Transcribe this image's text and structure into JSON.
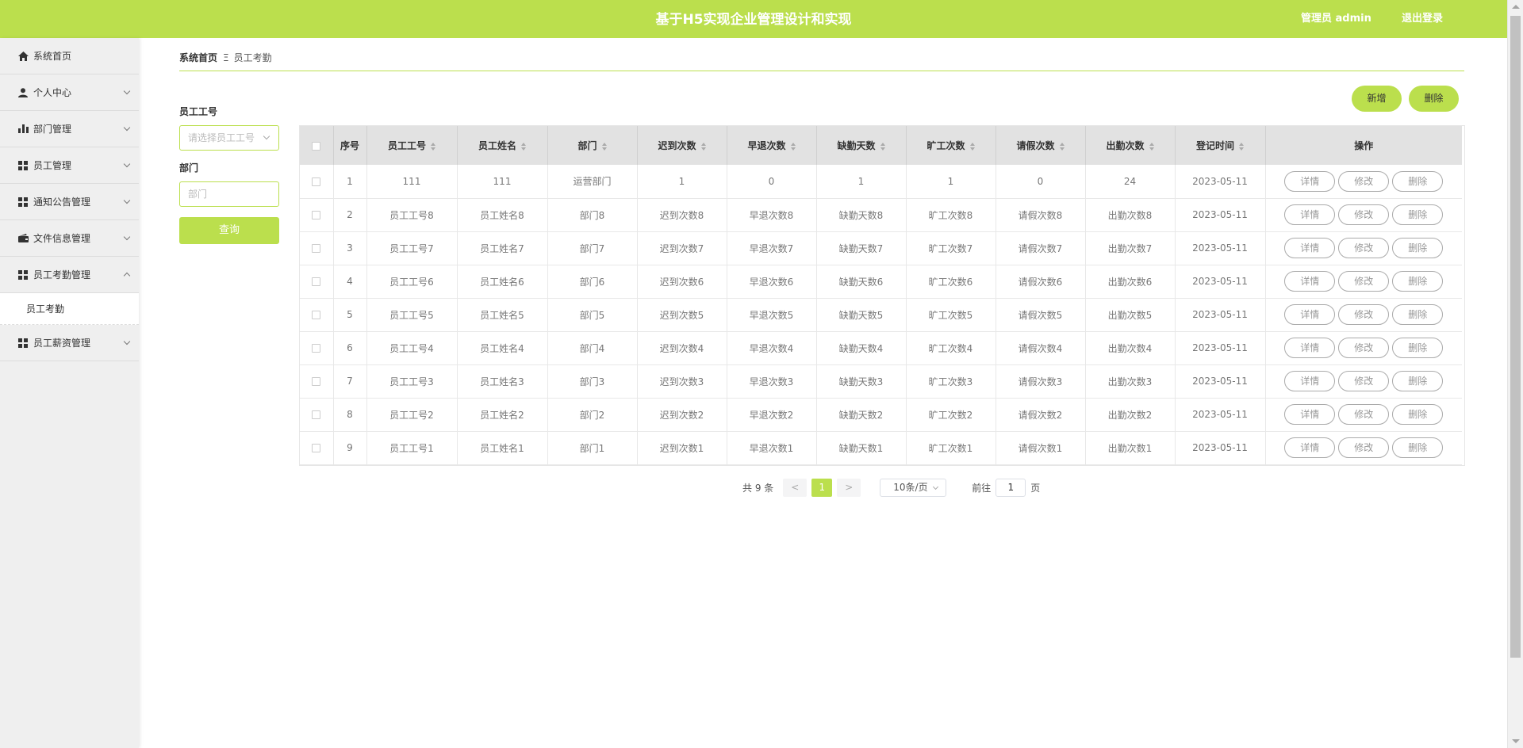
{
  "header": {
    "title": "基于H5实现企业管理设计和实现",
    "user": "管理员 admin",
    "logout": "退出登录"
  },
  "sidebar": {
    "items": [
      {
        "label": "系统首页"
      },
      {
        "label": "个人中心"
      },
      {
        "label": "部门管理"
      },
      {
        "label": "员工管理"
      },
      {
        "label": "通知公告管理"
      },
      {
        "label": "文件信息管理"
      },
      {
        "label": "员工考勤管理"
      },
      {
        "label": "员工薪资管理"
      }
    ],
    "subitem": "员工考勤"
  },
  "breadcrumb": {
    "home": "系统首页",
    "separator": "Ξ",
    "current": "员工考勤"
  },
  "search": {
    "emp_no_label": "员工工号",
    "emp_no_placeholder": "请选择员工工号",
    "dept_label": "部门",
    "dept_placeholder": "部门",
    "query": "查询"
  },
  "actions": {
    "add": "新增",
    "delete": "删除"
  },
  "table": {
    "headers": [
      "序号",
      "员工工号",
      "员工姓名",
      "部门",
      "迟到次数",
      "早退次数",
      "缺勤天数",
      "旷工次数",
      "请假次数",
      "出勤次数",
      "登记时间",
      "操作"
    ],
    "op_labels": {
      "detail": "详情",
      "edit": "修改",
      "delete": "删除"
    },
    "rows": [
      [
        "1",
        "111",
        "111",
        "运营部门",
        "1",
        "0",
        "1",
        "1",
        "0",
        "24",
        "2023-05-11"
      ],
      [
        "2",
        "员工工号8",
        "员工姓名8",
        "部门8",
        "迟到次数8",
        "早退次数8",
        "缺勤天数8",
        "旷工次数8",
        "请假次数8",
        "出勤次数8",
        "2023-05-11"
      ],
      [
        "3",
        "员工工号7",
        "员工姓名7",
        "部门7",
        "迟到次数7",
        "早退次数7",
        "缺勤天数7",
        "旷工次数7",
        "请假次数7",
        "出勤次数7",
        "2023-05-11"
      ],
      [
        "4",
        "员工工号6",
        "员工姓名6",
        "部门6",
        "迟到次数6",
        "早退次数6",
        "缺勤天数6",
        "旷工次数6",
        "请假次数6",
        "出勤次数6",
        "2023-05-11"
      ],
      [
        "5",
        "员工工号5",
        "员工姓名5",
        "部门5",
        "迟到次数5",
        "早退次数5",
        "缺勤天数5",
        "旷工次数5",
        "请假次数5",
        "出勤次数5",
        "2023-05-11"
      ],
      [
        "6",
        "员工工号4",
        "员工姓名4",
        "部门4",
        "迟到次数4",
        "早退次数4",
        "缺勤天数4",
        "旷工次数4",
        "请假次数4",
        "出勤次数4",
        "2023-05-11"
      ],
      [
        "7",
        "员工工号3",
        "员工姓名3",
        "部门3",
        "迟到次数3",
        "早退次数3",
        "缺勤天数3",
        "旷工次数3",
        "请假次数3",
        "出勤次数3",
        "2023-05-11"
      ],
      [
        "8",
        "员工工号2",
        "员工姓名2",
        "部门2",
        "迟到次数2",
        "早退次数2",
        "缺勤天数2",
        "旷工次数2",
        "请假次数2",
        "出勤次数2",
        "2023-05-11"
      ],
      [
        "9",
        "员工工号1",
        "员工姓名1",
        "部门1",
        "迟到次数1",
        "早退次数1",
        "缺勤天数1",
        "旷工次数1",
        "请假次数1",
        "出勤次数1",
        "2023-05-11"
      ]
    ]
  },
  "pagination": {
    "total": "共 9 条",
    "prev": "<",
    "current": "1",
    "next": ">",
    "page_size": "10条/页",
    "goto_prefix": "前往",
    "goto_value": "1",
    "goto_suffix": "页"
  },
  "colors": {
    "accent": "#bbdf4d"
  }
}
